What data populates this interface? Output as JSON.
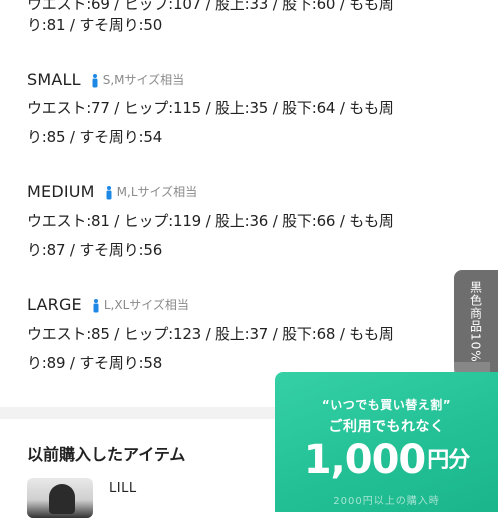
{
  "top_partial": {
    "line1": "ウエスト:69 / ヒップ:107 / 股上:33 / 股下:60 / もも周",
    "line2": "り:81 / すそ周り:50"
  },
  "sizes": [
    {
      "name": "SMALL",
      "fit": "S,Mサイズ相当",
      "line1": "ウエスト:77 / ヒップ:115 / 股上:35 / 股下:64 / もも周",
      "line2": "り:85 / すそ周り:54"
    },
    {
      "name": "MEDIUM",
      "fit": "M,Lサイズ相当",
      "line1": "ウエスト:81 / ヒップ:119 / 股上:36 / 股下:66 / もも周",
      "line2": "り:87 / すそ周り:56"
    },
    {
      "name": "LARGE",
      "fit": "L,XLサイズ相当",
      "line1": "ウエスト:85 / ヒップ:123 / 股上:37 / 股下:68 / もも周",
      "line2": "り:89 / すそ周り:58"
    }
  ],
  "previous": {
    "title": "以前購入したアイテム",
    "brand": "LILL"
  },
  "side_tab": {
    "label": "黒色商品10%"
  },
  "promo": {
    "line1": "“いつでも買い替え割”",
    "line2": "ご利用でもれなく",
    "amount": "1,000",
    "unit": "円分",
    "footer": "2000円以上の購入時"
  },
  "colors": {
    "accent_person": "#1e88e5",
    "promo_green": "#22bf95",
    "side_tab_gray": "#6e6e6e"
  },
  "icons": {
    "fit": "person-icon"
  }
}
